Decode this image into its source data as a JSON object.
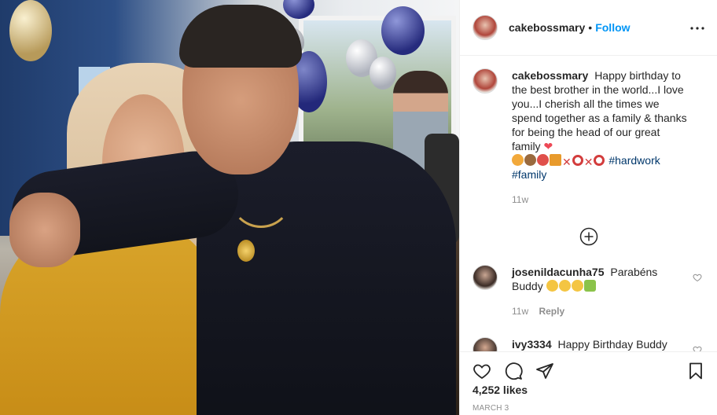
{
  "post": {
    "username": "cakebossmary",
    "separator": "•",
    "follow_label": "Follow"
  },
  "icons": {
    "more": "more-horizontal-icon",
    "like": "heart-icon",
    "comment": "comment-icon",
    "share": "paper-plane-icon",
    "save": "bookmark-icon",
    "load_more": "plus-circle-icon",
    "comment_like": "small-heart-icon"
  },
  "caption": {
    "username": "cakebossmary",
    "text": "Happy birthday to the best brother in the world...I love you...I cherish all the times we spend together as a family & thanks for being the head of our great family",
    "heart": "❤",
    "hashtag1": "#hardwork",
    "hashtag2": "#family",
    "time": "11w"
  },
  "comments": [
    {
      "username": "josenildacunha75",
      "text": "Parabéns Buddy",
      "time": "11w",
      "reply_label": "Reply"
    },
    {
      "username": "ivy3334",
      "text": "Happy Birthday Buddy May the Lord continues blessing"
    }
  ],
  "footer": {
    "likes": "4,252 likes",
    "date": "MARCH 3"
  },
  "colors": {
    "accent": "#0095f6",
    "hashtag": "#00376b",
    "muted": "#8e8e8e",
    "heart": "#ed4956"
  }
}
